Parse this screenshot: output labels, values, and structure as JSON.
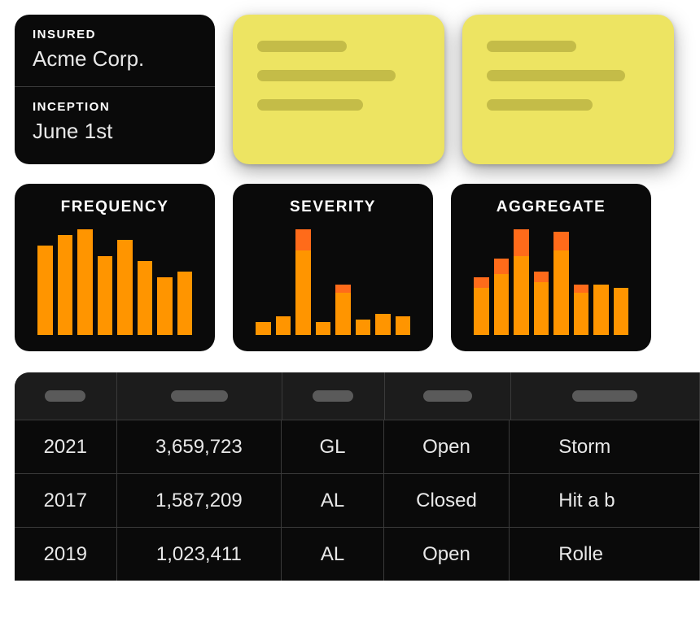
{
  "info": {
    "insured_label": "INSURED",
    "insured_value": "Acme Corp.",
    "inception_label": "INCEPTION",
    "inception_value": "June 1st"
  },
  "charts": [
    {
      "title": "FREQUENCY"
    },
    {
      "title": "SEVERITY"
    },
    {
      "title": "AGGREGATE"
    }
  ],
  "chart_data": [
    {
      "type": "bar",
      "title": "FREQUENCY",
      "categories": [
        "",
        "",
        "",
        "",
        "",
        "",
        "",
        ""
      ],
      "series": [
        {
          "name": "base",
          "values": [
            85,
            95,
            100,
            75,
            90,
            70,
            55,
            60
          ]
        },
        {
          "name": "top",
          "values": [
            0,
            0,
            0,
            0,
            0,
            0,
            0,
            0
          ]
        }
      ],
      "ylim": [
        0,
        100
      ]
    },
    {
      "type": "bar",
      "title": "SEVERITY",
      "categories": [
        "",
        "",
        "",
        "",
        "",
        "",
        "",
        ""
      ],
      "series": [
        {
          "name": "base",
          "values": [
            12,
            18,
            80,
            12,
            40,
            15,
            20,
            18
          ]
        },
        {
          "name": "top",
          "values": [
            0,
            0,
            20,
            0,
            8,
            0,
            0,
            0
          ]
        }
      ],
      "ylim": [
        0,
        100
      ]
    },
    {
      "type": "bar",
      "title": "AGGREGATE",
      "categories": [
        "",
        "",
        "",
        "",
        "",
        "",
        "",
        ""
      ],
      "series": [
        {
          "name": "base",
          "values": [
            45,
            58,
            75,
            50,
            80,
            40,
            48,
            45
          ]
        },
        {
          "name": "top",
          "values": [
            10,
            14,
            25,
            10,
            18,
            8,
            0,
            0
          ]
        }
      ],
      "ylim": [
        0,
        100
      ]
    }
  ],
  "table": {
    "header_pill_widths": [
      50,
      70,
      50,
      60,
      80
    ],
    "rows": [
      {
        "year": "2021",
        "amount": "3,659,723",
        "code": "GL",
        "status": "Open",
        "desc": "Storm"
      },
      {
        "year": "2017",
        "amount": "1,587,209",
        "code": "AL",
        "status": "Closed",
        "desc": "Hit a b"
      },
      {
        "year": "2019",
        "amount": "1,023,411",
        "code": "AL",
        "status": "Open",
        "desc": "Rolle"
      }
    ]
  }
}
